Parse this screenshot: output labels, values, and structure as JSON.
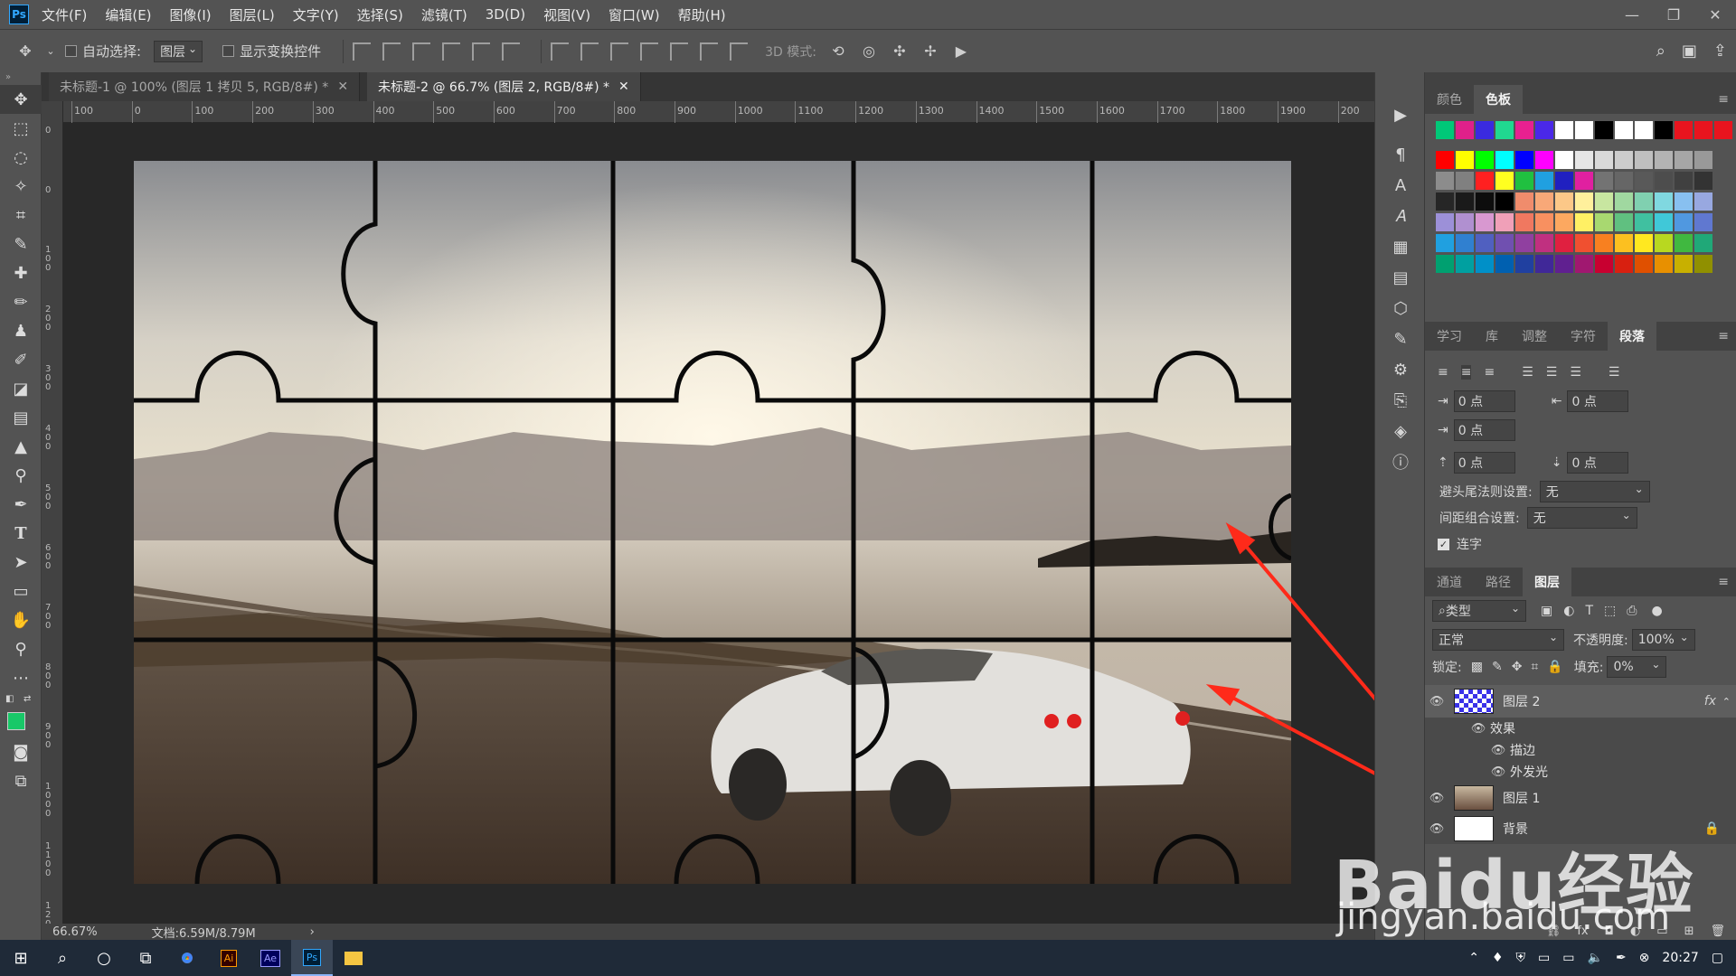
{
  "menubar": {
    "logo": "Ps",
    "items": [
      "文件(F)",
      "编辑(E)",
      "图像(I)",
      "图层(L)",
      "文字(Y)",
      "选择(S)",
      "滤镜(T)",
      "3D(D)",
      "视图(V)",
      "窗口(W)",
      "帮助(H)"
    ]
  },
  "optionsbar": {
    "auto_select_label": "自动选择:",
    "auto_select_value": "图层",
    "show_transform_label": "显示变换控件",
    "mode_3d_label": "3D 模式:"
  },
  "tabs": [
    {
      "label": "未标题-1 @ 100% (图层 1 拷贝 5, RGB/8#) *"
    },
    {
      "label": "未标题-2 @ 66.7% (图层 2, RGB/8#) *"
    }
  ],
  "ruler": {
    "h_labels": [
      "100",
      "0",
      "100",
      "200",
      "300",
      "400",
      "500",
      "600",
      "700",
      "800",
      "900",
      "1000",
      "1100",
      "1200",
      "1300",
      "1400",
      "1500",
      "1600",
      "1700",
      "1800",
      "1900",
      "200"
    ],
    "v_labels": [
      "0",
      "0",
      "100",
      "200",
      "300",
      "400",
      "500",
      "600",
      "700",
      "800",
      "900",
      "1000",
      "1100",
      "1200"
    ]
  },
  "statusbar": {
    "zoom": "66.67%",
    "doc": "文档:6.59M/8.79M"
  },
  "swatches_panel": {
    "tabs": [
      "颜色",
      "色板"
    ],
    "active": "色板",
    "colors": {
      "recent": [
        "#00c878",
        "#e0208a",
        "#3a2ae0",
        "#20d890",
        "#e82090",
        "#4a28e8",
        "#ffffff",
        "#ffffff",
        "#000000",
        "#ffffff",
        "#ffffff",
        "#000000",
        "#e8141e",
        "#e8141e",
        "#e8141e"
      ],
      "rows": [
        [
          "#ff0000",
          "#ffff00",
          "#00ff00",
          "#00ffff",
          "#0000ff",
          "#ff00ff",
          "#ffffff",
          "#e6e6e6",
          "#d9d9d9",
          "#cccccc",
          "#bfbfbf",
          "#b3b3b3",
          "#a6a6a6",
          "#999999"
        ],
        [
          "#8c8c8c",
          "#808080",
          "#ff2020",
          "#ffff20",
          "#20c040",
          "#20a0e0",
          "#2020c0",
          "#e020a0",
          "#737373",
          "#666666",
          "#595959",
          "#4d4d4d",
          "#404040",
          "#333333"
        ],
        [
          "#262626",
          "#1a1a1a",
          "#0d0d0d",
          "#000000",
          "#f08c6c",
          "#f8a878",
          "#fcc888",
          "#fff09c",
          "#c8e6a0",
          "#a0d8a0",
          "#80d0b0",
          "#80d8e0",
          "#88c0f0",
          "#98a8e0"
        ],
        [
          "#9c90d8",
          "#b090d0",
          "#d898d0",
          "#f0a0b8",
          "#f07860",
          "#f89060",
          "#fca860",
          "#fff064",
          "#a8d870",
          "#60c080",
          "#40c0a0",
          "#40c8d8",
          "#5098e0",
          "#6078d0"
        ],
        [
          "#20a0e0",
          "#3080d0",
          "#5060c0",
          "#7050b0",
          "#9040a0",
          "#c03080",
          "#e02040",
          "#f05030",
          "#f88020",
          "#fcc020",
          "#ffe820",
          "#b8d820",
          "#40b840",
          "#20a878"
        ],
        [
          "#00a070",
          "#00a0a0",
          "#0090c8",
          "#0060b0",
          "#2040a0",
          "#402898",
          "#602090",
          "#a01870",
          "#c80030",
          "#d82010",
          "#e05000",
          "#e89000",
          "#c8b000",
          "#909000"
        ]
      ]
    }
  },
  "paragraph_panel": {
    "tabs": [
      "学习",
      "库",
      "调整",
      "字符",
      "段落"
    ],
    "active": "段落",
    "indent_left": "0 点",
    "indent_right": "0 点",
    "indent_first": "0 点",
    "space_before": "0 点",
    "space_after": "0 点",
    "kinsoku_label": "避头尾法则设置:",
    "kinsoku_value": "无",
    "mojikumi_label": "间距组合设置:",
    "mojikumi_value": "无",
    "hyphenate_label": "连字"
  },
  "layers_panel": {
    "tabs": [
      "通道",
      "路径",
      "图层"
    ],
    "active": "图层",
    "filter_label": "类型",
    "blend_mode": "正常",
    "opacity_label": "不透明度:",
    "opacity_value": "100%",
    "lock_label": "锁定:",
    "fill_label": "填充:",
    "fill_value": "0%",
    "layers": [
      {
        "name": "图层 2",
        "fx": "fx"
      },
      {
        "name": "效果"
      },
      {
        "name": "描边"
      },
      {
        "name": "外发光"
      },
      {
        "name": "图层 1"
      },
      {
        "name": "背景"
      }
    ]
  },
  "taskbar": {
    "time": "20:27",
    "apps": [
      "Ai",
      "Ae",
      "Ps"
    ]
  },
  "watermark": {
    "line1": "Baidu经验",
    "line2": "jingyan.baidu.com"
  },
  "annotation": {
    "highlight_color": "#ff2a1a"
  }
}
